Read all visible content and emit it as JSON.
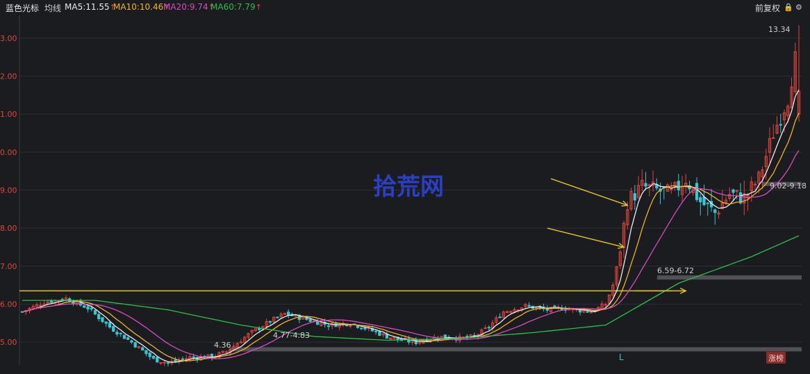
{
  "header": {
    "stock_name": "蓝色光标",
    "indicator": "均线",
    "ma5": "MA5:11.55",
    "ma10": "MA10:10.46",
    "ma20": "MA20:9.74",
    "ma60": "MA60:7.79",
    "up_arrow": "↑",
    "adjust_label": "前复权",
    "lock_icon": "lock-icon",
    "settings_icon": "gear-icon"
  },
  "colors": {
    "background": "#1b1c20",
    "up": "#e0453c",
    "down": "#39c5d6",
    "ma5": "#ececec",
    "ma10": "#f0b429",
    "ma20": "#d94ac5",
    "ma60": "#2fbf4a",
    "support_line": "#e8c12a",
    "zone": "#5a5a5f",
    "watermark": "#2a3fc4"
  },
  "chart_data": {
    "type": "candlestick",
    "ylim": [
      4.4,
      13.6
    ],
    "yticks": [
      "3.00",
      "2.00",
      "1.00",
      "0.00",
      "9.00",
      "8.00",
      "7.00",
      "6.00",
      "5.00"
    ],
    "ytick_values": [
      13,
      12,
      11,
      10,
      9,
      8,
      7,
      6,
      5
    ],
    "watermark": "拾荒网",
    "annotations": {
      "high": "13.34",
      "low": "4.36",
      "zone1": "4.77-4.83",
      "zone2": "6.59-6.72",
      "zone3": "9.02-9.18",
      "bottom_marker": "L",
      "bottom_badge": "涨榜"
    },
    "support_level": 6.35,
    "zones": [
      {
        "label": "4.77-4.83",
        "y_low": 4.77,
        "y_high": 4.83
      },
      {
        "label": "6.59-6.72",
        "y_low": 6.59,
        "y_high": 6.72
      },
      {
        "label": "9.02-9.18",
        "y_low": 9.02,
        "y_high": 9.18
      }
    ],
    "trend": [
      [
        0,
        5.8
      ],
      [
        6,
        6.05
      ],
      [
        12,
        6.15
      ],
      [
        18,
        5.9
      ],
      [
        24,
        5.4
      ],
      [
        30,
        5.0
      ],
      [
        36,
        4.55
      ],
      [
        40,
        4.45
      ],
      [
        46,
        4.6
      ],
      [
        52,
        4.62
      ],
      [
        56,
        4.75
      ],
      [
        62,
        5.2
      ],
      [
        68,
        5.55
      ],
      [
        72,
        5.75
      ],
      [
        78,
        5.6
      ],
      [
        84,
        5.45
      ],
      [
        90,
        5.5
      ],
      [
        96,
        5.3
      ],
      [
        100,
        5.15
      ],
      [
        104,
        5.05
      ],
      [
        108,
        5.0
      ],
      [
        112,
        5.1
      ],
      [
        116,
        5.15
      ],
      [
        120,
        5.1
      ],
      [
        124,
        5.15
      ],
      [
        128,
        5.4
      ],
      [
        132,
        5.8
      ],
      [
        138,
        5.95
      ],
      [
        144,
        5.85
      ],
      [
        148,
        5.9
      ],
      [
        152,
        5.85
      ],
      [
        156,
        5.8
      ],
      [
        160,
        6.0
      ],
      [
        162,
        6.5
      ],
      [
        164,
        7.4
      ],
      [
        166,
        8.7
      ],
      [
        170,
        9.1
      ],
      [
        174,
        9.0
      ],
      [
        178,
        8.9
      ],
      [
        182,
        9.3
      ],
      [
        186,
        8.7
      ],
      [
        190,
        8.4
      ],
      [
        194,
        8.9
      ],
      [
        198,
        8.8
      ],
      [
        202,
        9.3
      ],
      [
        206,
        10.5
      ],
      [
        210,
        11.4
      ],
      [
        213,
        13.0
      ]
    ],
    "ma60_curve": [
      [
        0,
        6.1
      ],
      [
        20,
        6.1
      ],
      [
        40,
        5.85
      ],
      [
        60,
        5.45
      ],
      [
        80,
        5.15
      ],
      [
        100,
        5.05
      ],
      [
        120,
        5.1
      ],
      [
        140,
        5.25
      ],
      [
        160,
        5.45
      ],
      [
        170,
        6.0
      ],
      [
        180,
        6.55
      ],
      [
        190,
        6.9
      ],
      [
        200,
        7.25
      ],
      [
        213,
        7.8
      ]
    ],
    "arrows": [
      {
        "from": [
          145,
          9.3
        ],
        "to": [
          166,
          8.6
        ]
      },
      {
        "from": [
          144,
          8.0
        ],
        "to": [
          165,
          7.5
        ]
      },
      {
        "from": [
          168,
          6.35
        ],
        "to": [
          182,
          6.35
        ]
      }
    ]
  }
}
